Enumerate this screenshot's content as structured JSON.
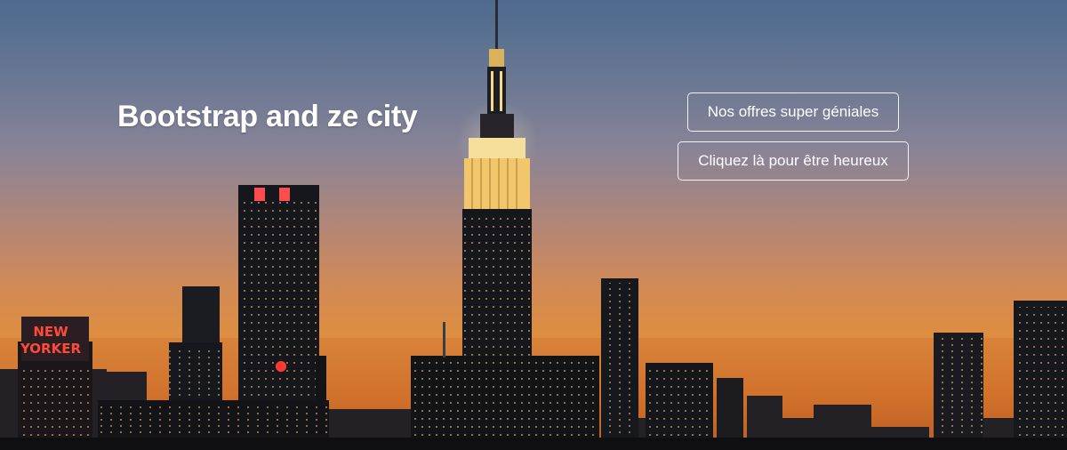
{
  "hero": {
    "title": "Bootstrap and ze city",
    "neon_sign": [
      "NEW",
      "YORKER"
    ]
  },
  "buttons": {
    "offers_label": "Nos offres super géniales",
    "happy_label": "Cliquez là pour être heureux"
  },
  "colors": {
    "sky_top": "#4d6a8e",
    "sky_horizon": "#e08e3e",
    "building": "#141416",
    "window_light": "#f2c66a",
    "neon_red": "#ff3b30",
    "spire_glow": "#f6df9a"
  }
}
